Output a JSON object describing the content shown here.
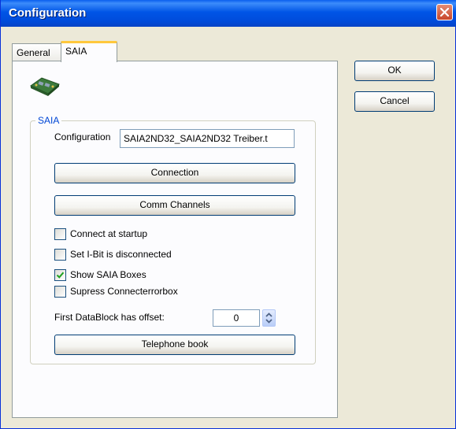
{
  "window": {
    "title": "Configuration",
    "close_icon": "close-icon"
  },
  "tabs": [
    {
      "label": "General",
      "selected": false
    },
    {
      "label": "SAIA",
      "selected": true
    }
  ],
  "saia_logo_icon": "saia-device-icon",
  "group": {
    "label": "SAIA",
    "configuration_label": "Configuration",
    "configuration_value": "SAIA2ND32_SAIA2ND32 Treiber.t",
    "connection_button": "Connection",
    "comm_channels_button": "Comm Channels",
    "checkboxes": [
      {
        "label": "Connect at startup",
        "checked": false
      },
      {
        "label": "Set I-Bit is disconnected",
        "checked": false
      },
      {
        "label": "Show SAIA Boxes",
        "checked": true
      },
      {
        "label": "Supress Connecterrorbox",
        "checked": false
      }
    ],
    "offset_label": "First DataBlock has offset:",
    "offset_value": "0",
    "telephone_book_button": "Telephone book"
  },
  "buttons": {
    "ok": "OK",
    "cancel": "Cancel"
  },
  "colors": {
    "titlebar": "#0055E6",
    "group_label": "#0046D5",
    "check_mark": "#21A121",
    "close_button": "#C8462B"
  }
}
